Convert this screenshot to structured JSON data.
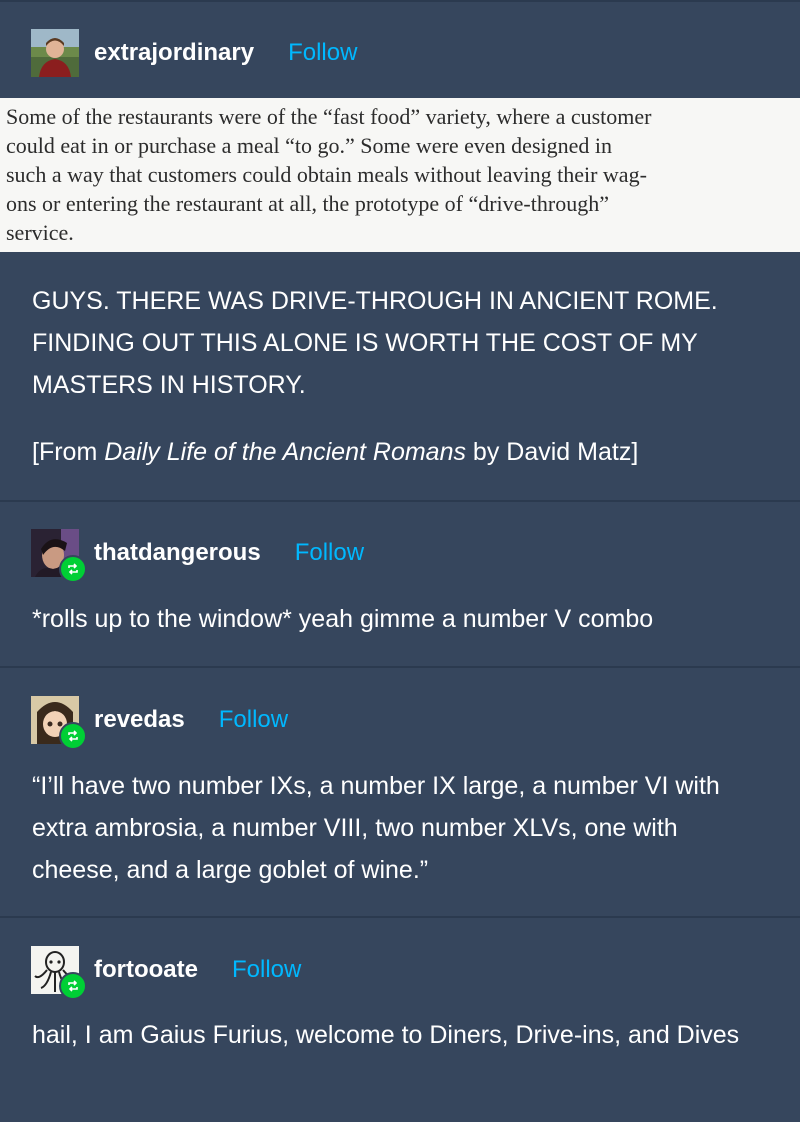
{
  "posts": [
    {
      "username": "extrajordinary",
      "follow_label": "Follow",
      "avatar_icon": "person-photo-avatar",
      "quoted_excerpt_lines": [
        "Some of the restaurants were of the “fast food” variety, where a customer",
        "could eat in or purchase a meal “to go.” Some were even designed in",
        "such a way that customers could obtain meals without leaving their wag-",
        "ons or entering the restaurant at all, the prototype of “drive-through”",
        "service."
      ],
      "paragraphs": [
        "GUYS. THERE WAS DRIVE-THROUGH IN ANCIENT ROME. FINDING OUT THIS ALONE IS WORTH THE COST OF MY MASTERS IN HISTORY."
      ],
      "citation": {
        "prefix": "[From ",
        "title": "Daily Life of the Ancient Romans",
        "suffix": " by David Matz]"
      }
    },
    {
      "username": "thatdangerous",
      "follow_label": "Follow",
      "avatar_icon": "dark-portrait-avatar",
      "badge_icon": "reblog-icon",
      "text": "*rolls up to the window* yeah gimme a number V combo"
    },
    {
      "username": "revedas",
      "follow_label": "Follow",
      "avatar_icon": "anime-character-avatar",
      "badge_icon": "reblog-icon",
      "text": "“I’ll have two number IXs, a number IX large, a number VI with extra ambrosia, a number VIII, two number XLVs, one with cheese, and a large goblet of wine.”"
    },
    {
      "username": "fortooate",
      "follow_label": "Follow",
      "avatar_icon": "octopus-drawing-avatar",
      "badge_icon": "reblog-icon",
      "text": "hail, I am Gaius Furius, welcome to Diners, Drive-ins, and Dives"
    }
  ],
  "colors": {
    "background": "#36465d",
    "follow": "#00b8ff",
    "reblog_badge": "#00cf35",
    "divider": "#2b3a4f"
  }
}
